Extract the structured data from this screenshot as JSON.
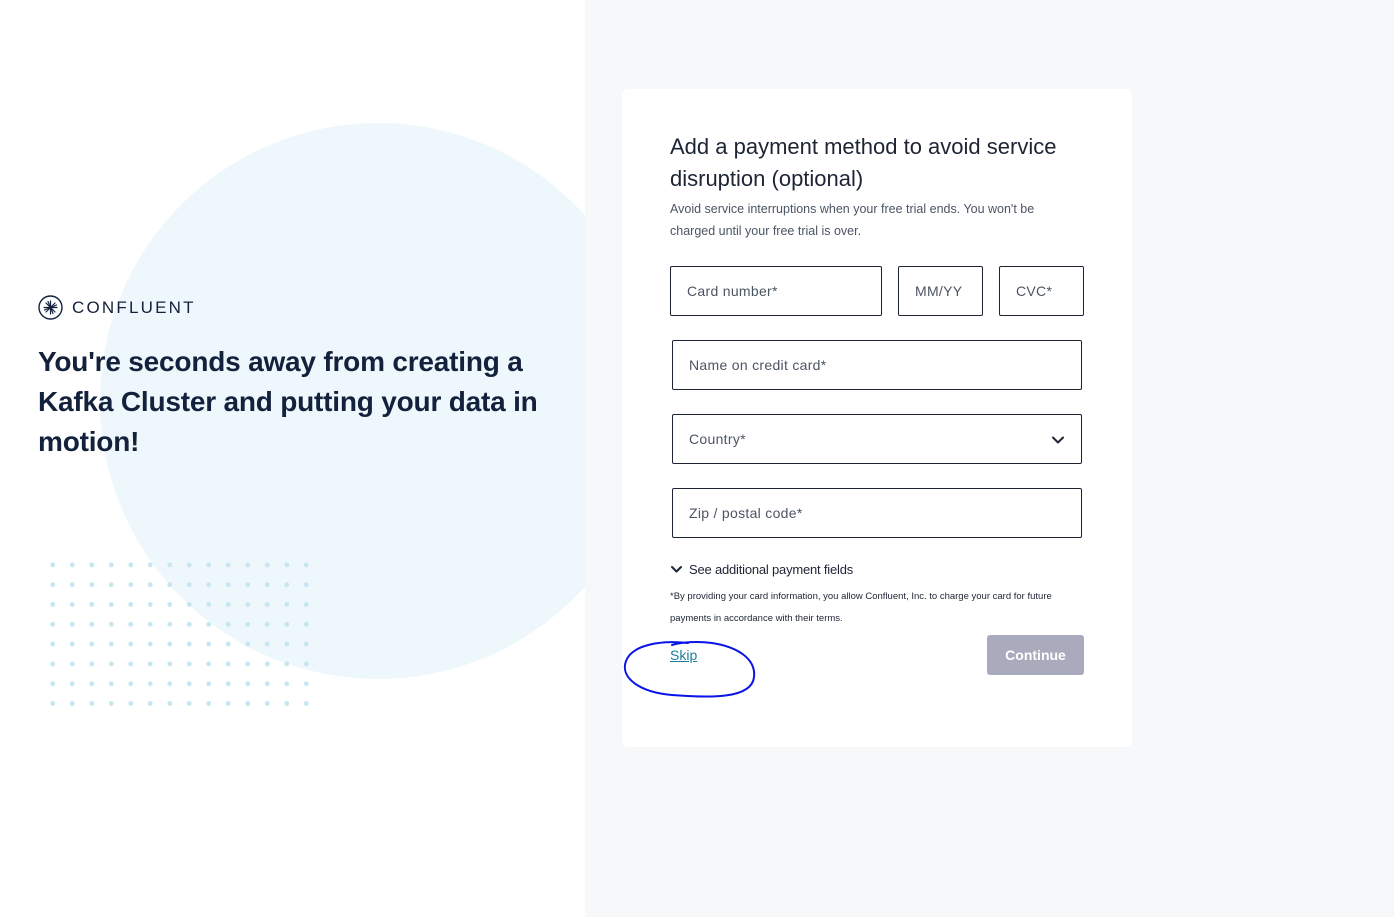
{
  "brand": {
    "name": "CONFLUENT",
    "icon": "confluent-logo-icon"
  },
  "hero": {
    "headline": "You're seconds away from creating a Kafka Cluster and putting your data in motion!"
  },
  "payment_form": {
    "title": "Add a payment method to avoid service disruption (optional)",
    "subtitle": "Avoid service interruptions when your free trial ends. You won't be charged until your free trial is over.",
    "fields": {
      "card_number": {
        "placeholder": "Card number*",
        "value": ""
      },
      "expiry": {
        "placeholder": "MM/YY",
        "value": ""
      },
      "cvc": {
        "placeholder": "CVC*",
        "value": ""
      },
      "name_on_card": {
        "placeholder": "Name on credit card*",
        "value": ""
      },
      "country": {
        "label": "Country*",
        "icon": "chevron-down-icon"
      },
      "zip": {
        "placeholder": "Zip / postal code*",
        "value": ""
      }
    },
    "additional_fields_label": "See additional payment fields",
    "disclaimer": "*By providing your card information, you allow Confluent, Inc. to charge your card for future payments in accordance with their terms.",
    "skip_label": "Skip",
    "continue_label": "Continue"
  },
  "annotation": {
    "color": "#0a14e6",
    "shape": "hand-drawn-circle"
  },
  "colors": {
    "heading": "#14213d",
    "panel_bg": "#f7f8fa",
    "circle_bg": "#eef7fb",
    "link": "#1a7f9e",
    "button_disabled": "#a9abbc"
  }
}
